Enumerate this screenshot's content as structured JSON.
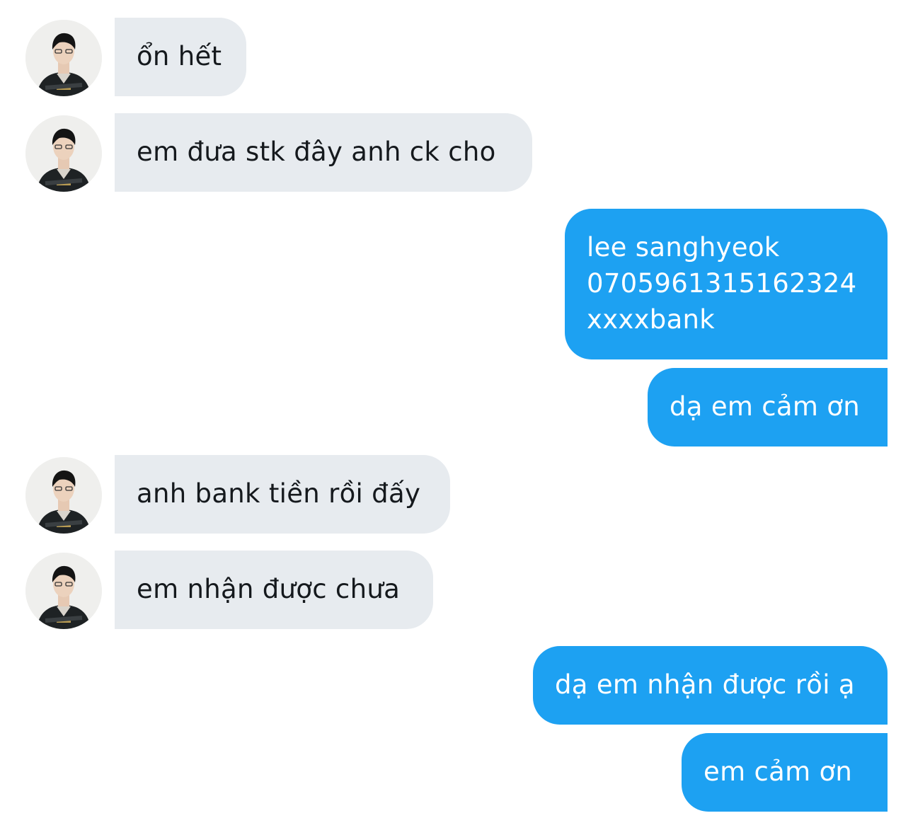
{
  "conversation": {
    "messages": [
      {
        "sender": "other",
        "text": "ổn hết"
      },
      {
        "sender": "other",
        "text": "em đưa stk đây anh ck cho"
      },
      {
        "sender": "me",
        "text": "lee sanghyeok\n0705961315162324\nxxxxbank"
      },
      {
        "sender": "me",
        "text": "dạ em cảm ơn"
      },
      {
        "sender": "other",
        "text": "anh bank tiền rồi đấy"
      },
      {
        "sender": "other",
        "text": "em nhận được chưa"
      },
      {
        "sender": "me",
        "text": "dạ em nhận được rồi ạ"
      },
      {
        "sender": "me",
        "text": "em cảm ơn"
      }
    ]
  },
  "colors": {
    "incoming_bubble": "#e7ebef",
    "outgoing_bubble": "#1da1f2",
    "incoming_text": "#15191d",
    "outgoing_text": "#ffffff"
  },
  "icons": {
    "avatar": "profile-photo-avatar-icon"
  }
}
